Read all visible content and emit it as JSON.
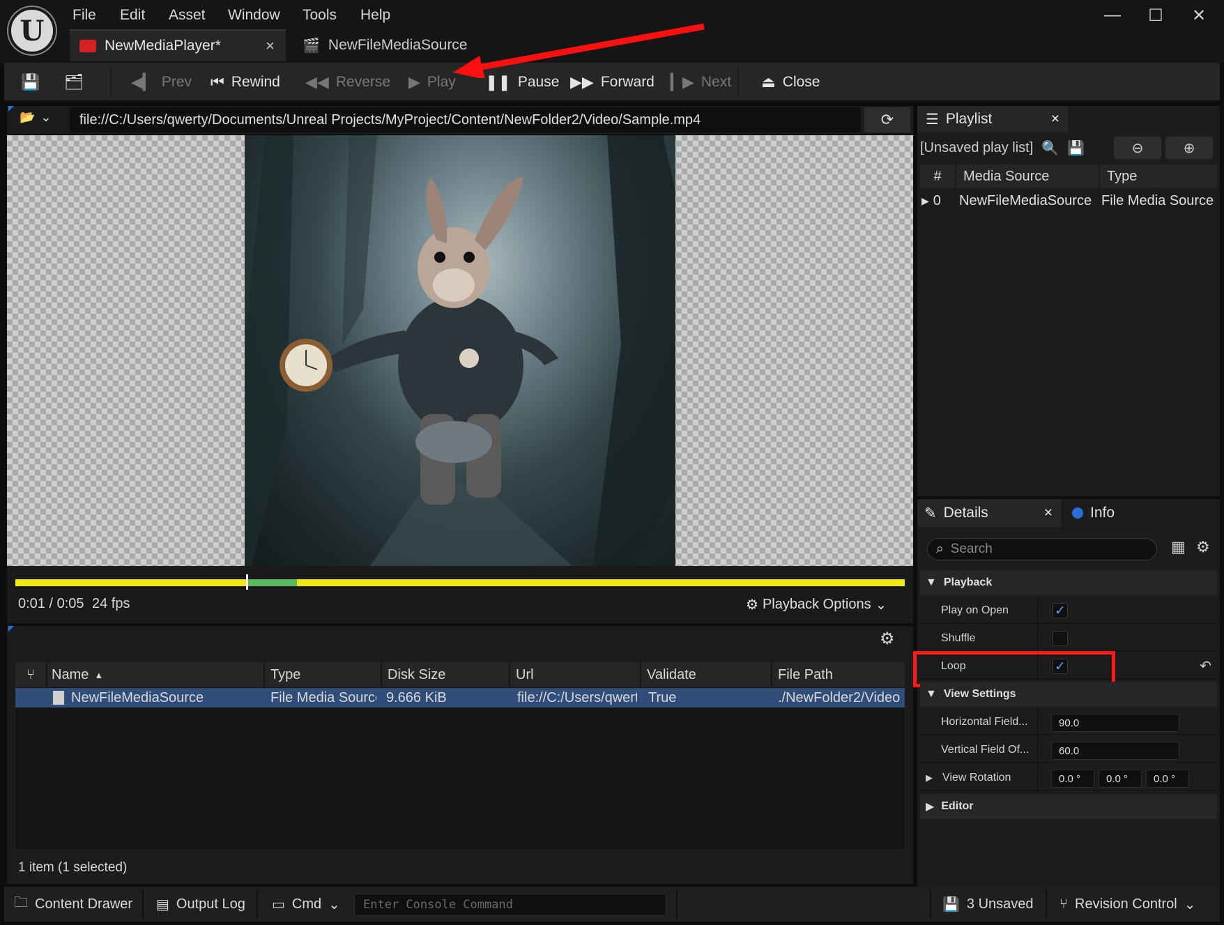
{
  "menu": [
    "File",
    "Edit",
    "Asset",
    "Window",
    "Tools",
    "Help"
  ],
  "tabs": [
    {
      "label": "NewMediaPlayer*",
      "close": "×"
    },
    {
      "label": "NewFileMediaSource"
    }
  ],
  "window_controls": {
    "minimize": "—",
    "maximize": "☐",
    "close": "✕"
  },
  "toolbar": {
    "prev": "Prev",
    "rewind": "Rewind",
    "reverse": "Reverse",
    "play": "Play",
    "pause": "Pause",
    "forward": "Forward",
    "next": "Next",
    "close": "Close"
  },
  "url": "file://C:/Users/qwerty/Documents/Unreal Projects/MyProject/Content/NewFolder2/Video/Sample.mp4",
  "timeline": {
    "time": "0:01 / 0:05",
    "fps": "24 fps",
    "progress": 0.26,
    "playback_options": "Playback Options"
  },
  "assets": {
    "columns": [
      "Name",
      "Type",
      "Disk Size",
      "Url",
      "Validate",
      "File Path"
    ],
    "rows": [
      {
        "name": "NewFileMediaSource",
        "type": "File Media Source",
        "disk_size": "9.666 KiB",
        "url": "file://C:/Users/qwerty",
        "validate": "True",
        "file_path": "./NewFolder2/Video"
      }
    ],
    "count": "1 item (1 selected)"
  },
  "playlist": {
    "tab": "Playlist",
    "name": "[Unsaved play list]",
    "columns": [
      "#",
      "Media Source",
      "Type"
    ],
    "rows": [
      {
        "index": "0",
        "media_source": "NewFileMediaSource",
        "type": "File Media Source"
      }
    ]
  },
  "details": {
    "tab": "Details",
    "info_tab": "Info",
    "search_placeholder": "Search",
    "playback": {
      "title": "Playback",
      "play_on_open": {
        "label": "Play on Open",
        "checked": true
      },
      "shuffle": {
        "label": "Shuffle",
        "checked": false
      },
      "loop": {
        "label": "Loop",
        "checked": true
      }
    },
    "view_settings": {
      "title": "View Settings",
      "hfov": {
        "label": "Horizontal Field...",
        "value": "90.0"
      },
      "vfov": {
        "label": "Vertical Field Of...",
        "value": "60.0"
      },
      "rotation": {
        "label": "View Rotation",
        "values": [
          "0.0 °",
          "0.0 °",
          "0.0 °"
        ]
      }
    },
    "editor": {
      "title": "Editor"
    }
  },
  "statusbar": {
    "content_drawer": "Content Drawer",
    "output_log": "Output Log",
    "cmd": "Cmd",
    "console_placeholder": "Enter Console Command",
    "unsaved": "3 Unsaved",
    "revision_control": "Revision Control"
  },
  "colors": {
    "accent_highlight": "#ff1a1a",
    "timeline_track": "#f0e814",
    "timeline_buffer": "#5cb85c",
    "selection": "#2f4d78",
    "checkbox": "#4da3ff"
  }
}
